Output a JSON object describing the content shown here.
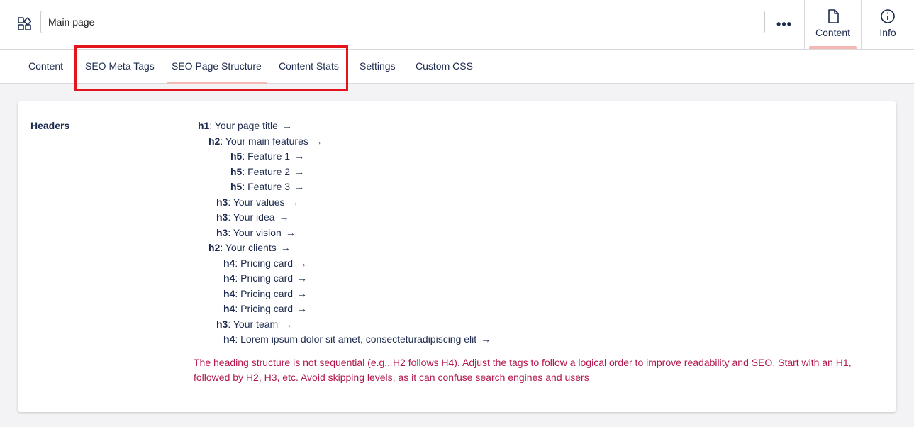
{
  "header": {
    "page_name_value": "Main page",
    "more_label": "•••",
    "tabs": [
      {
        "label": "Content",
        "icon": "document-icon",
        "active": true
      },
      {
        "label": "Info",
        "icon": "info-icon",
        "active": false
      }
    ]
  },
  "nav": {
    "tabs": [
      {
        "label": "Content",
        "active": false
      },
      {
        "label": "SEO Meta Tags",
        "active": false
      },
      {
        "label": "SEO Page Structure",
        "active": true
      },
      {
        "label": "Content Stats",
        "active": false
      },
      {
        "label": "Settings",
        "active": false
      },
      {
        "label": "Custom CSS",
        "active": false
      }
    ]
  },
  "structure": {
    "label": "Headers",
    "arrow": "→",
    "headings": [
      {
        "tag": "h1",
        "text": "Your page title"
      },
      {
        "tag": "h2",
        "text": "Your main features"
      },
      {
        "tag": "h5",
        "text": "Feature 1"
      },
      {
        "tag": "h5",
        "text": "Feature 2"
      },
      {
        "tag": "h5",
        "text": "Feature 3"
      },
      {
        "tag": "h3",
        "text": "Your values"
      },
      {
        "tag": "h3",
        "text": "Your idea"
      },
      {
        "tag": "h3",
        "text": "Your vision"
      },
      {
        "tag": "h2",
        "text": "Your clients"
      },
      {
        "tag": "h4",
        "text": "Pricing card"
      },
      {
        "tag": "h4",
        "text": "Pricing card"
      },
      {
        "tag": "h4",
        "text": "Pricing card"
      },
      {
        "tag": "h4",
        "text": "Pricing card"
      },
      {
        "tag": "h3",
        "text": "Your team"
      },
      {
        "tag": "h4",
        "text": "Lorem ipsum dolor sit amet, consecteturadipiscing elit"
      }
    ],
    "warning": "The heading structure is not sequential (e.g., H2 follows H4). Adjust the tags to follow a logical order to improve readability and SEO. Start with an H1, followed by H2, H3, etc. Avoid skipping levels, as it can confuse search engines and users"
  },
  "colors": {
    "accent": "#f5b9b5",
    "highlight": "#e3141b",
    "warning": "#b3184a",
    "text": "#1b2a4e"
  }
}
